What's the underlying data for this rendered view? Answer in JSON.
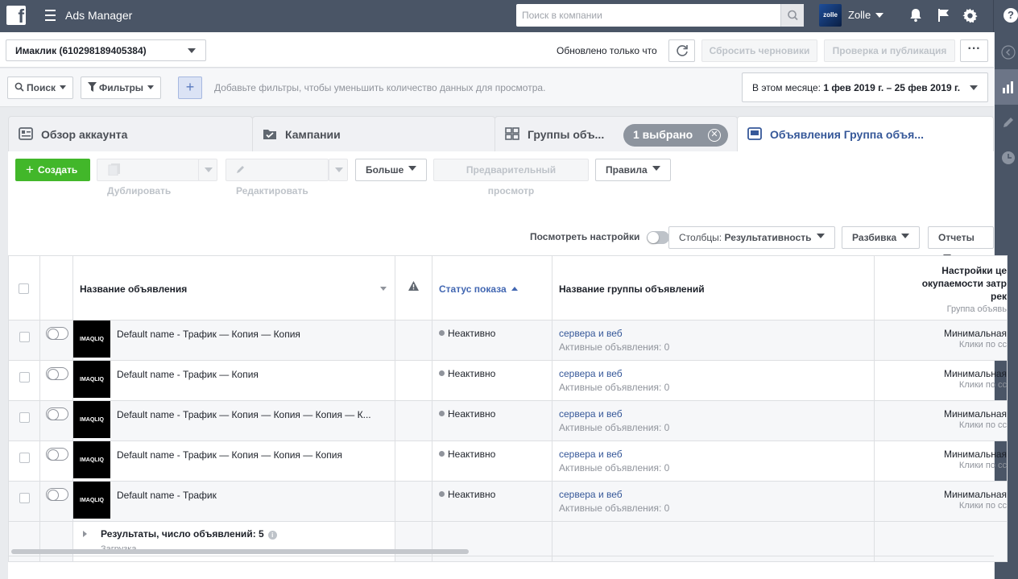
{
  "topbar": {
    "app_title": "Ads Manager",
    "search_placeholder": "Поиск в компании",
    "avatar_text": "zolle",
    "username": "Zolle",
    "help": "?"
  },
  "account": {
    "name": "Имаклик (610298189405384)",
    "updated": "Обновлено только что",
    "discard": "Сбросить черновики",
    "publish": "Проверка и публикация",
    "more": "···"
  },
  "filters": {
    "search": "Поиск",
    "filters": "Фильтры",
    "plus": "+",
    "hint": "Добавьте фильтры, чтобы уменьшить количество данных для просмотра.",
    "date_prefix": "В этом месяце: ",
    "date_range": "1 фев 2019 г. – 25 фев 2019 г."
  },
  "tabs": [
    {
      "label": "Обзор аккаунта"
    },
    {
      "label": "Кампании"
    },
    {
      "label": "Группы объ..."
    },
    {
      "label": "Объявления Группа объя..."
    }
  ],
  "chip": {
    "label": "1 выбрано",
    "close": "✕"
  },
  "toolbar": {
    "create": "Создать",
    "duplicate": "Дублировать",
    "edit": "Редактировать",
    "more": "Больше",
    "preview": "Предварительный просмотр",
    "rules": "Правила",
    "view_settings": "Посмотреть настройки",
    "columns_prefix": "Столбцы: ",
    "columns_value": "Результативность",
    "breakdown": "Разбивка",
    "reports": "Отчеты"
  },
  "table": {
    "headers": {
      "ad_name": "Название объявления",
      "status": "Статус показа",
      "adset_name": "Название группы объявлений",
      "bid_1": "Настройки це",
      "bid_2": "окупаемости затр",
      "bid_3": "рек",
      "bid_sub": "Группа объявь"
    },
    "thumb_text": "IMAQLIQ",
    "rows": [
      {
        "name": "Default name - Трафик — Копия — Копия",
        "status": "Неактивно",
        "adset": "сервера и веб",
        "adset_sub": "Активные объявления: 0",
        "bid": "Минимальная",
        "bid_sub": "Клики по сс"
      },
      {
        "name": "Default name - Трафик — Копия",
        "status": "Неактивно",
        "adset": "сервера и веб",
        "adset_sub": "Активные объявления: 0",
        "bid": "Минимальная",
        "bid_sub": "Клики по сс"
      },
      {
        "name": "Default name - Трафик — Копия — Копия — Копия — К...",
        "status": "Неактивно",
        "adset": "сервера и веб",
        "adset_sub": "Активные объявления: 0",
        "bid": "Минимальная",
        "bid_sub": "Клики по сс"
      },
      {
        "name": "Default name - Трафик — Копия — Копия — Копия",
        "status": "Неактивно",
        "adset": "сервера и веб",
        "adset_sub": "Активные объявления: 0",
        "bid": "Минимальная",
        "bid_sub": "Клики по сс"
      },
      {
        "name": "Default name - Трафик",
        "status": "Неактивно",
        "adset": "сервера и веб",
        "adset_sub": "Активные объявления: 0",
        "bid": "Минимальная",
        "bid_sub": "Клики по сс"
      }
    ],
    "summary": {
      "title": "Результаты, число объявлений: 5",
      "loading": "Загрузка..."
    }
  }
}
